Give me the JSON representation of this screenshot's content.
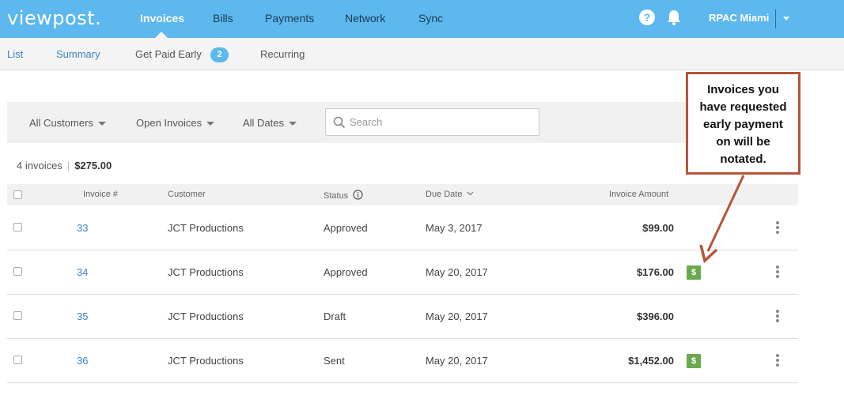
{
  "app": {
    "logo": "viewpost."
  },
  "top_nav": {
    "items": [
      {
        "label": "Invoices",
        "active": true
      },
      {
        "label": "Bills",
        "active": false
      },
      {
        "label": "Payments",
        "active": false
      },
      {
        "label": "Network",
        "active": false
      },
      {
        "label": "Sync",
        "active": false
      }
    ],
    "help_icon": "question-circle-icon",
    "bell_icon": "bell-icon",
    "user": "RPAC Miami"
  },
  "sub_nav": {
    "items": [
      {
        "label": "List"
      },
      {
        "label": "Summary"
      },
      {
        "label": "Get Paid Early",
        "badge": "2"
      },
      {
        "label": "Recurring"
      }
    ]
  },
  "filters": {
    "customers": "All Customers",
    "invoices": "Open Invoices",
    "dates": "All Dates",
    "search_placeholder": "Search"
  },
  "summary": {
    "count": "4 invoices",
    "separator": "|",
    "total": "$275.00"
  },
  "table": {
    "headers": {
      "invoice": "Invoice #",
      "customer": "Customer",
      "status": "Status",
      "due_date": "Due Date",
      "amount": "Invoice Amount"
    },
    "rows": [
      {
        "invoice": "33",
        "customer": "JCT Productions",
        "status": "Approved",
        "due_date": "May 3, 2017",
        "amount": "$99.00",
        "early_pay": false
      },
      {
        "invoice": "34",
        "customer": "JCT Productions",
        "status": "Approved",
        "due_date": "May 20, 2017",
        "amount": "$176.00",
        "early_pay": true,
        "badge": "$"
      },
      {
        "invoice": "35",
        "customer": "JCT Productions",
        "status": "Draft",
        "due_date": "May 20, 2017",
        "amount": "$396.00",
        "early_pay": false
      },
      {
        "invoice": "36",
        "customer": "JCT Productions",
        "status": "Sent",
        "due_date": "May 20, 2017",
        "amount": "$1,452.00",
        "early_pay": true,
        "badge": "$"
      }
    ]
  },
  "callout": {
    "lines": [
      "Invoices you",
      "have requested",
      "early payment",
      "on will be",
      "notated."
    ]
  },
  "colors": {
    "topbar": "#5cb8ee",
    "link": "#3a84c9",
    "early_pay_badge": "#6aa84f",
    "callout_border": "#b85438"
  }
}
